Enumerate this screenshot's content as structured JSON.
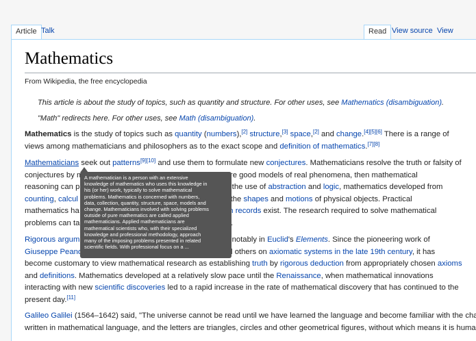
{
  "tabs": {
    "article": "Article",
    "talk": "Talk",
    "read": "Read",
    "view_source": "View source",
    "view_history": "View history"
  },
  "page": {
    "title": "Mathematics",
    "tagline": "From Wikipedia, the free encyclopedia"
  },
  "hatnotes": [
    {
      "text": "This article is about the study of topics, such as quantity and structure. For other uses, see ",
      "link": "Mathematics (disambiguation)",
      "tail": "."
    },
    {
      "text": "\"Math\" redirects here. For other uses, see ",
      "link": "Math (disambiguation)",
      "tail": "."
    }
  ],
  "para1": {
    "l1": {
      "bold": "Mathematics",
      "t1": " is the study of topics such as ",
      "a1": "quantity",
      "t2": " (",
      "a2": "numbers",
      "t3": "),",
      "r1": "[2]",
      "a3": "structure",
      "t4": ",",
      "r2": "[3]",
      "a4": "space",
      "t5": ",",
      "r3": "[2]",
      "t6": " and ",
      "a5": "change",
      "t7": ".",
      "r4": "[4][5][6]",
      "t8": " There is a range of"
    },
    "l2": {
      "t1": "views among mathematicians and philosophers as to the exact scope and ",
      "a1": "definition of mathematics",
      "t2": ".",
      "r1": "[7][8]"
    }
  },
  "para2": {
    "l1": {
      "a1": "Mathematicians",
      "t1": " seek out ",
      "a2": "patterns",
      "r1": "[9][10]",
      "t2": " and use them to formulate new ",
      "a3": "conjectures",
      "t3": ". Mathematicians resolve the truth or falsity of"
    },
    "l2": {
      "t1": "conjectures by m",
      "t2": "tures are good models of real phenomena, then mathematical"
    },
    "l3": {
      "t1": "reasoning can p",
      "t2": "ough the use of ",
      "a1": "abstraction",
      "t3": " and ",
      "a2": "logic",
      "t4": ", mathematics developed from"
    },
    "l4": {
      "a1": "counting",
      "t1": ", ",
      "a2": "calcul",
      "t2": " of the ",
      "a3": "shapes",
      "t3": " and ",
      "a4": "motions",
      "t4": " of physical objects. Practical"
    },
    "l5": {
      "t1": "mathematics ha",
      "a1": "tten records",
      "t2": " exist. The research required to solve mathematical"
    },
    "l6": {
      "t1": "problems can ta",
      "t2": "y."
    }
  },
  "para3": {
    "l1": {
      "a1": "Rigorous argum",
      "t1": "ost notably in ",
      "a2": "Euclid",
      "t2": "'s ",
      "a3": "Elements",
      "t3": ". Since the pioneering work of"
    },
    "l2": {
      "a1": "Giuseppe Peano",
      "t1": " d others on ",
      "a2": "axiomatic systems",
      "t2": " ",
      "a3": "in the late 19th century",
      "t3": ", it has"
    },
    "l3": {
      "t1": "become customary to view mathematical research as establishing ",
      "a1": "truth",
      "t2": " by ",
      "a2": "rigorous deduction",
      "t3": " from appropriately chosen ",
      "a3": "axioms"
    },
    "l4": {
      "t1": "and ",
      "a1": "definitions",
      "t2": ". Mathematics developed at a relatively slow pace until the ",
      "a2": "Renaissance",
      "t3": ", when mathematical innovations"
    },
    "l5": {
      "t1": "interacting with new ",
      "a1": "scientific discoveries",
      "t2": " led to a rapid increase in the rate of mathematical discovery that has continued to the"
    },
    "l6": {
      "t1": "present day.",
      "r1": "[11]"
    }
  },
  "para4": {
    "l1": {
      "a1": "Galileo Galilei",
      "t1": " (1564–1642) said, \"The universe cannot be read until we have learned the language and become familiar with the cha"
    },
    "l2": {
      "t1": "written in mathematical language, and the letters are triangles, circles and other geometrical figures, without which means it is huma"
    }
  },
  "popup": {
    "lines": [
      "A mathematician is a person with an extensive",
      "knowledge of mathematics who uses this knowledge in",
      "his (or her) work, typically to solve mathematical",
      "problems. Mathematics is concerned with numbers,",
      "data, collection, quantity, structure, space, models and",
      "change. Mathematicians involved with solving problems",
      "outside of pure mathematics are called applied",
      "mathematicians. Applied mathematicians are",
      "mathematical scientists who, with their specialized",
      "knowledge and professional methodology, approach",
      "many of the imposing problems presented in related",
      "scientific fields. With professional focus on a ..."
    ]
  }
}
